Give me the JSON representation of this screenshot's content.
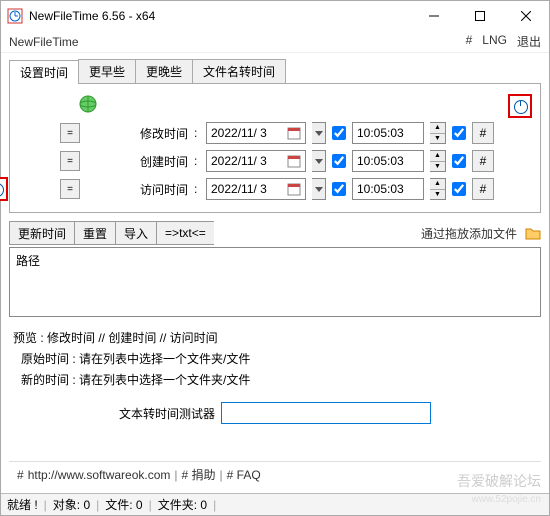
{
  "window": {
    "title": "NewFileTime 6.56 - x64"
  },
  "menubar": {
    "app_name": "NewFileTime",
    "hash": "#",
    "lng": "LNG",
    "exit": "退出"
  },
  "tabs": [
    {
      "label": "设置时间",
      "active": true
    },
    {
      "label": "更早些",
      "active": false
    },
    {
      "label": "更晚些",
      "active": false
    },
    {
      "label": "文件名转时间",
      "active": false
    }
  ],
  "rows": [
    {
      "eq": "=",
      "label": "修改时间",
      "date": "2022/11/ 3",
      "chk1": true,
      "time": "10:05:03",
      "chk2": true,
      "hash": "#"
    },
    {
      "eq": "=",
      "label": "创建时间",
      "date": "2022/11/ 3",
      "chk1": true,
      "time": "10:05:03",
      "chk2": true,
      "hash": "#"
    },
    {
      "eq": "=",
      "label": "访问时间",
      "date": "2022/11/ 3",
      "chk1": true,
      "time": "10:05:03",
      "chk2": true,
      "hash": "#"
    }
  ],
  "toolbar2": {
    "update": "更新时间",
    "reset": "重置",
    "import": "导入",
    "txt": "=>txt<=",
    "drag_hint": "通过拖放添加文件"
  },
  "list": {
    "header": "路径"
  },
  "preview": {
    "line": "预览 :    修改时间    //    创建时间    //    访问时间",
    "orig_label": "原始时间 :",
    "orig_val": "请在列表中选择一个文件夹/文件",
    "new_label": "新的时间 :",
    "new_val": "请在列表中选择一个文件夹/文件"
  },
  "tester": {
    "label": "文本转时间测试器",
    "value": ""
  },
  "bottom": {
    "hash": "#",
    "url": "http://www.softwareok.com",
    "donate": "# 捐助",
    "faq": "# FAQ"
  },
  "watermark": {
    "main": "吾爱破解论坛",
    "sub": "www.52pojie.cn"
  },
  "status": {
    "ready": "就绪 !",
    "objects": "对象: 0",
    "files": "文件: 0",
    "folders": "文件夹: 0"
  }
}
